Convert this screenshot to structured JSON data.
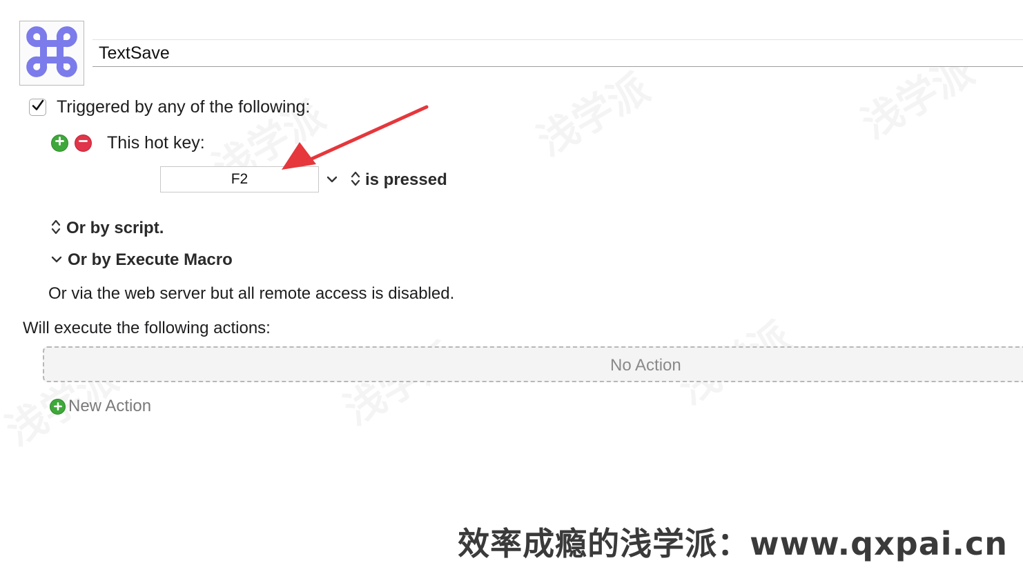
{
  "macro": {
    "icon": "command-key-icon",
    "name": "TextSave"
  },
  "triggers": {
    "enabled": true,
    "header": "Triggered by any of the following:",
    "hotkey": {
      "label": "This hot key:",
      "key": "F2",
      "condition": "is pressed"
    },
    "by_script": "Or by script.",
    "by_execute_macro": "Or by Execute Macro",
    "web_server_note": "Or via the web server but all remote access is disabled."
  },
  "actions": {
    "header": "Will execute the following actions:",
    "empty_label": "No Action",
    "new_action_label": "New Action"
  },
  "watermark": {
    "text": "浅学派",
    "footer": "效率成瘾的浅学派：www.qxpai.cn"
  },
  "colors": {
    "icon_purple": "#7b7bec",
    "add_green": "#3fa83a",
    "remove_red": "#e0354a",
    "annotation_red": "#e5373c"
  }
}
